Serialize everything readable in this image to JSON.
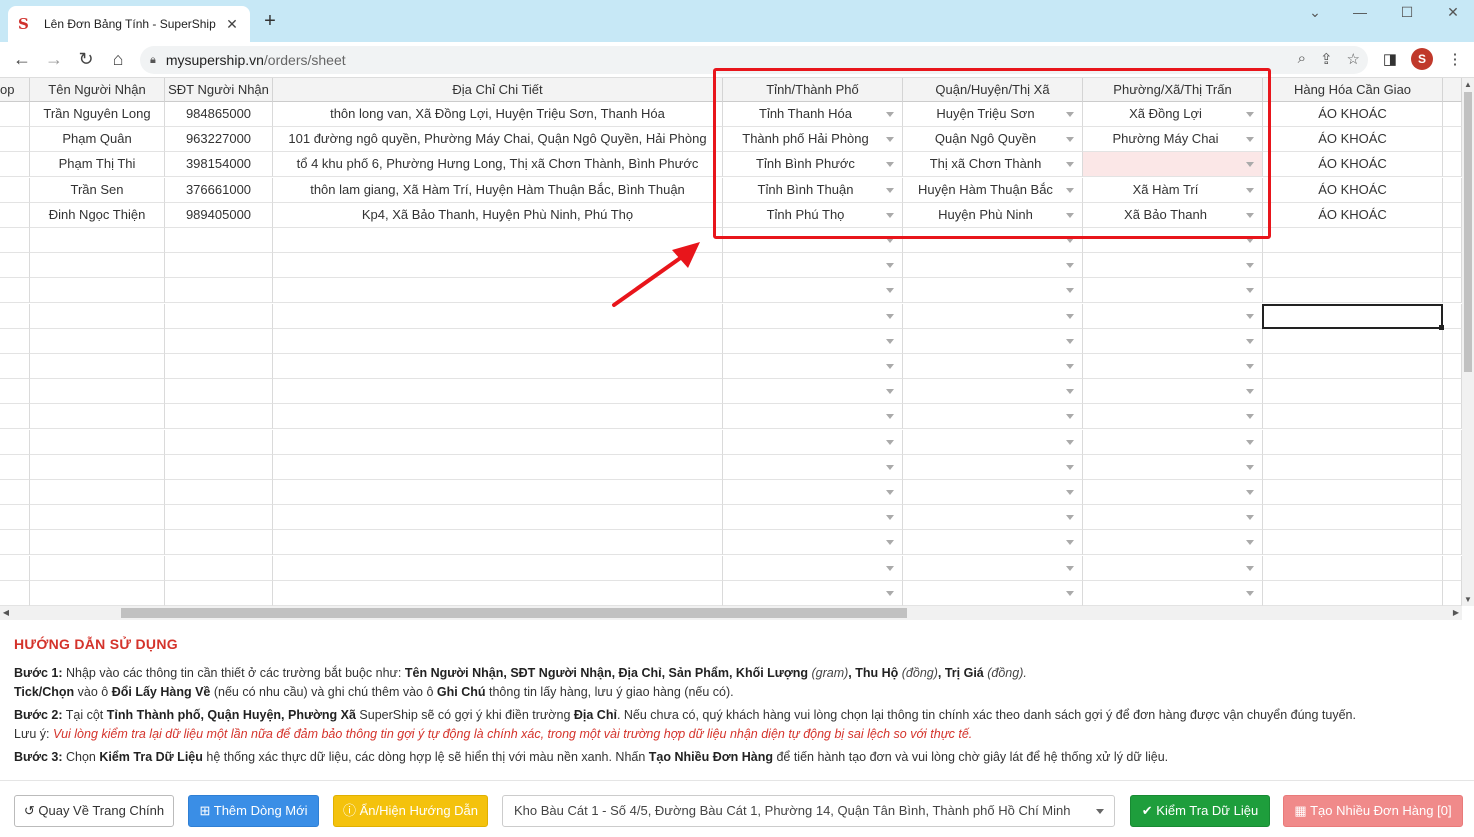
{
  "browser": {
    "tab_title": "Lên Đơn Bảng Tính - SuperShip",
    "tab_favicon": "S",
    "url_host": "mysupership.vn",
    "url_path": "/orders/sheet",
    "avatar_letter": "S"
  },
  "sheet": {
    "columns": [
      {
        "label": "op"
      },
      {
        "label": "Tên Người Nhận"
      },
      {
        "label": "SĐT Người Nhận"
      },
      {
        "label": "Địa Chỉ Chi Tiết"
      },
      {
        "label": "Tỉnh/Thành Phố"
      },
      {
        "label": "Quận/Huyện/Thị Xã"
      },
      {
        "label": "Phường/Xã/Thị Trấn"
      },
      {
        "label": "Hàng Hóa Cần Giao"
      }
    ],
    "rows": [
      {
        "name": "Trần Nguyên Long",
        "phone": "984865000",
        "address": "thôn long van, Xã Đồng Lợi, Huyện Triệu Sơn, Thanh Hóa",
        "province": "Tỉnh Thanh Hóa",
        "district": "Huyện Triệu Sơn",
        "ward": "Xã Đồng Lợi",
        "goods": "ÁO KHOÁC"
      },
      {
        "name": "Phạm Quân",
        "phone": "963227000",
        "address": "101 đường ngô quyền, Phường Máy Chai, Quận Ngô Quyền, Hải Phòng",
        "province": "Thành phố Hải Phòng",
        "district": "Quận Ngô Quyền",
        "ward": "Phường Máy Chai",
        "goods": "ÁO KHOÁC"
      },
      {
        "name": "Phạm Thị Thi",
        "phone": "398154000",
        "address": "tổ 4 khu phố 6, Phường Hưng Long, Thị xã Chơn Thành, Bình Phước",
        "province": "Tỉnh Bình Phước",
        "district": "Thị xã Chơn Thành",
        "ward": "",
        "goods": "ÁO KHOÁC"
      },
      {
        "name": "Trần Sen",
        "phone": "376661000",
        "address": "thôn lam giang, Xã Hàm Trí, Huyện Hàm Thuận Bắc, Bình Thuận",
        "province": "Tỉnh Bình Thuận",
        "district": "Huyện Hàm Thuận Bắc",
        "ward": "Xã Hàm Trí",
        "goods": "ÁO KHOÁC"
      },
      {
        "name": "Đinh Ngọc Thiện",
        "phone": "989405000",
        "address": "Kp4, Xã Bảo Thanh, Huyện Phù Ninh, Phú Thọ",
        "province": "Tỉnh Phú Thọ",
        "district": "Huyện Phù Ninh",
        "ward": "Xã Bảo Thanh",
        "goods": "ÁO KHOÁC"
      }
    ],
    "empty_rows": 15
  },
  "guide": {
    "title": "HƯỚNG DẪN SỬ DỤNG",
    "step1_label": "Bước 1:",
    "step1_a": " Nhập vào các thông tin cần thiết ở các trường bắt buộc như: ",
    "step1_fields": "Tên Người Nhận, SĐT Người Nhận, Địa Chỉ, Sản Phẩm, Khối Lượng",
    "step1_gram": " (gram)",
    "step1_cod": ", Thu Hộ",
    "step1_dong1": " (đồng)",
    "step1_value": ", Trị Giá",
    "step1_dong2": " (đồng).",
    "step1b_label": "Tick/Chọn",
    "step1b_a": " vào ô ",
    "step1b_field": "Đổi Lấy Hàng Về",
    "step1b_b": " (nếu có nhu cầu) và ghi chú thêm vào ô ",
    "step1b_note": "Ghi Chú",
    "step1b_c": " thông tin lấy hàng, lưu ý giao hàng (nếu có).",
    "step2_label": "Bước 2:",
    "step2_a": " Tại cột ",
    "step2_cols": "Tỉnh Thành phố, Quận Huyện, Phường Xã",
    "step2_b": " SuperShip sẽ có gợi ý khi điền trường ",
    "step2_field": "Địa Chỉ",
    "step2_c": ". Nếu chưa có, quý khách hàng vui lòng chọn lại thông tin chính xác theo danh sách gợi ý để đơn hàng được vận chuyển đúng tuyến.",
    "note_label": "Lưu ý: ",
    "note_text": "Vui lòng kiểm tra lại dữ liệu một lần nữa để đảm bảo thông tin gợi ý tự động là chính xác, trong một vài trường hợp dữ liệu nhận diện tự động bị sai lệch so với thực tế.",
    "step3_label": "Bước 3:",
    "step3_a": " Chọn ",
    "step3_check": "Kiểm Tra Dữ Liệu",
    "step3_b": " hệ thống xác thực dữ liệu, các dòng hợp lệ sẽ hiển thị với màu nền xanh. Nhấn ",
    "step3_create": "Tạo Nhiều Đơn Hàng",
    "step3_c": " để tiến hành tạo đơn và vui lòng chờ giây lát để hệ thống xử lý dữ liệu."
  },
  "footer": {
    "back_label": "Quay Về Trang Chính",
    "add_row_label": "Thêm Dòng Mới",
    "toggle_guide_label": "Ẩn/Hiện Hướng Dẫn",
    "warehouse_selected": "Kho Bàu Cát 1 - Số 4/5, Đường Bàu Cát 1, Phường 14, Quận Tân Bình, Thành phố Hồ Chí Minh",
    "check_label": "Kiểm Tra Dữ Liệu",
    "create_label": "Tạo Nhiều Đơn Hàng [0]"
  },
  "colors": {
    "highlight": "#e8151b",
    "guide_title": "#d4332b",
    "primary": "#3a8ee6",
    "warning": "#f4c20d",
    "success": "#1e9e3c",
    "danger": "#f08a8a"
  }
}
